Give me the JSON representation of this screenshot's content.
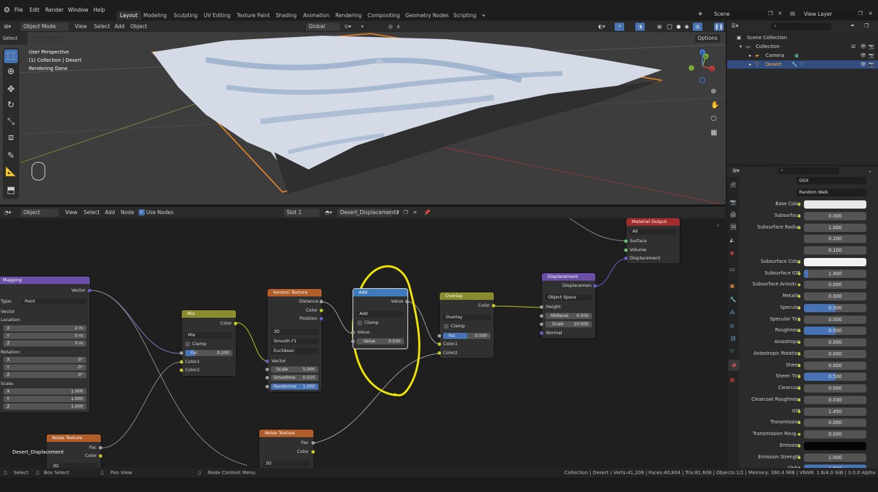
{
  "topbar": {
    "menus": [
      "File",
      "Edit",
      "Render",
      "Window",
      "Help"
    ],
    "workspaces": [
      "Layout",
      "Modeling",
      "Sculpting",
      "UV Editing",
      "Texture Paint",
      "Shading",
      "Animation",
      "Rendering",
      "Compositing",
      "Geometry Nodes",
      "Scripting"
    ],
    "add_tab": "+",
    "scene_label": "Scene",
    "view_layer_label": "View Layer"
  },
  "viewport_header": {
    "mode": "Object Mode",
    "menus": [
      "View",
      "Select",
      "Add",
      "Object"
    ],
    "transform": "Global",
    "select_box": "Select Box",
    "options": "Options"
  },
  "viewport": {
    "info_lines": [
      "User Perspective",
      "(1) Collection | Desert",
      "Rendering Done"
    ],
    "gizmo_axes": [
      "X",
      "Y",
      "Z"
    ]
  },
  "node_header": {
    "editor": "Object",
    "menus": [
      "View",
      "Select",
      "Add",
      "Node"
    ],
    "use_nodes": "Use Nodes",
    "slot": "Slot 1",
    "material": "Desert_Displacement"
  },
  "nodes": {
    "mapping": {
      "title": "Mapping",
      "out": "Vector",
      "type_label": "Type:",
      "type_value": "Point",
      "vector_label": "Vector",
      "location_label": "Location:",
      "rotation_label": "Rotation:",
      "scale_label": "Scale:",
      "loc": [
        [
          "X",
          "2 m"
        ],
        [
          "Y",
          "0 m"
        ],
        [
          "Z",
          "0 m"
        ]
      ],
      "rot": [
        [
          "X",
          "0°"
        ],
        [
          "Y",
          "0°"
        ],
        [
          "Z",
          "0°"
        ]
      ],
      "scl": [
        [
          "X",
          "1.000"
        ],
        [
          "Y",
          "1.000"
        ],
        [
          "Z",
          "1.000"
        ]
      ]
    },
    "mix": {
      "title": "Mix",
      "out": "Color",
      "mode": "Mix",
      "clamp": "Clamp",
      "fac_label": "Fac",
      "fac_value": "0.200",
      "in1": "Color1",
      "in2": "Color2"
    },
    "voronoi": {
      "title": "Voronoi Texture",
      "outs": [
        "Distance",
        "Color",
        "Position"
      ],
      "dim": "3D",
      "feature": "Smooth F1",
      "metric": "Euclidean",
      "vector": "Vector",
      "fields": [
        [
          "Scale",
          "5.000"
        ],
        [
          "Smoothne",
          "0.010"
        ],
        [
          "Randomne",
          "1.000"
        ]
      ]
    },
    "add": {
      "title": "Add",
      "out": "Value",
      "op": "Add",
      "clamp": "Clamp",
      "in": "Value",
      "val_label": "Value",
      "val": "0.500"
    },
    "overlay": {
      "title": "Overlay",
      "out": "Color",
      "mode": "Overlay",
      "clamp": "Clamp",
      "fac_label": "Fac",
      "fac_value": "0.500",
      "in1": "Color1",
      "in2": "Color2"
    },
    "displacement": {
      "title": "Displacement",
      "out": "Displacemen",
      "space": "Object Space",
      "height": "Height",
      "midlevel_label": "Midlevel",
      "midlevel": "0.500",
      "scale_label": "Scale",
      "scale": "10.000",
      "normal": "Normal"
    },
    "material_output": {
      "title": "Material Output",
      "target": "All",
      "ins": [
        "Surface",
        "Volume",
        "Displacement"
      ]
    },
    "noise1": {
      "title": "Noise Texture",
      "outs": [
        "Fac",
        "Color"
      ],
      "dim": "3D"
    },
    "noise2": {
      "title": "Noise Texture",
      "outs": [
        "Fac",
        "Color"
      ],
      "dim": "3D"
    },
    "frame_label": "Desert_Displacement"
  },
  "outliner": {
    "root": "Scene Collection",
    "items": [
      {
        "name": "Collection"
      },
      {
        "name": "Camera"
      },
      {
        "name": "Desert"
      }
    ]
  },
  "properties": {
    "distribution": "GGX",
    "subsurface_method": "Random Walk",
    "rows": [
      {
        "label": "Base Color",
        "value": "",
        "kind": "color",
        "color": "#e8e8e8"
      },
      {
        "label": "Subsurface",
        "value": "0.000"
      },
      {
        "label": "Subsurface Radius",
        "value": "1.000"
      },
      {
        "label": "",
        "value": "0.200"
      },
      {
        "label": "",
        "value": "0.100"
      },
      {
        "label": "Subsurface Color",
        "value": "",
        "kind": "color",
        "color": "#f2f2f2"
      },
      {
        "label": "Subsurface IOR",
        "value": "1.400",
        "fill": 0.07
      },
      {
        "label": "Subsurface Anisotr...",
        "value": "0.000"
      },
      {
        "label": "Metallic",
        "value": "0.000"
      },
      {
        "label": "Specular",
        "value": "0.500",
        "fill": 0.5
      },
      {
        "label": "Specular Tint",
        "value": "0.000"
      },
      {
        "label": "Roughness",
        "value": "0.500",
        "fill": 0.5
      },
      {
        "label": "Anisotropic",
        "value": "0.000"
      },
      {
        "label": "Anisotropic Rotation",
        "value": "0.000"
      },
      {
        "label": "Sheen",
        "value": "0.000"
      },
      {
        "label": "Sheen Tint",
        "value": "0.500",
        "fill": 0.5
      },
      {
        "label": "Clearcoat",
        "value": "0.000"
      },
      {
        "label": "Clearcoat Roughness",
        "value": "0.030"
      },
      {
        "label": "IOR",
        "value": "1.450"
      },
      {
        "label": "Transmission",
        "value": "0.000"
      },
      {
        "label": "Transmission Roug...",
        "value": "0.000"
      },
      {
        "label": "Emission",
        "value": "",
        "kind": "color",
        "color": "#050505"
      },
      {
        "label": "Emission Strength",
        "value": "1.000"
      },
      {
        "label": "Alpha",
        "value": "1.000",
        "fill": 1.0
      }
    ]
  },
  "statusbar": {
    "select": "Select",
    "box_select": "Box Select",
    "pan_view": "Pan View",
    "node_menu": "Node Context Menu",
    "stats": "Collection | Desert | Verts:41,209 | Faces:40,804 | Tris:81,608 | Objects:1/2 | Memory: 390.4 MiB | VRAM: 1.6/4.0 GiB | 3.0.0 Alpha"
  },
  "colors": {
    "accent": "#4772b3",
    "selected": "#334d80",
    "annotation": "#f2e600",
    "object_outline": "#f08a24"
  }
}
